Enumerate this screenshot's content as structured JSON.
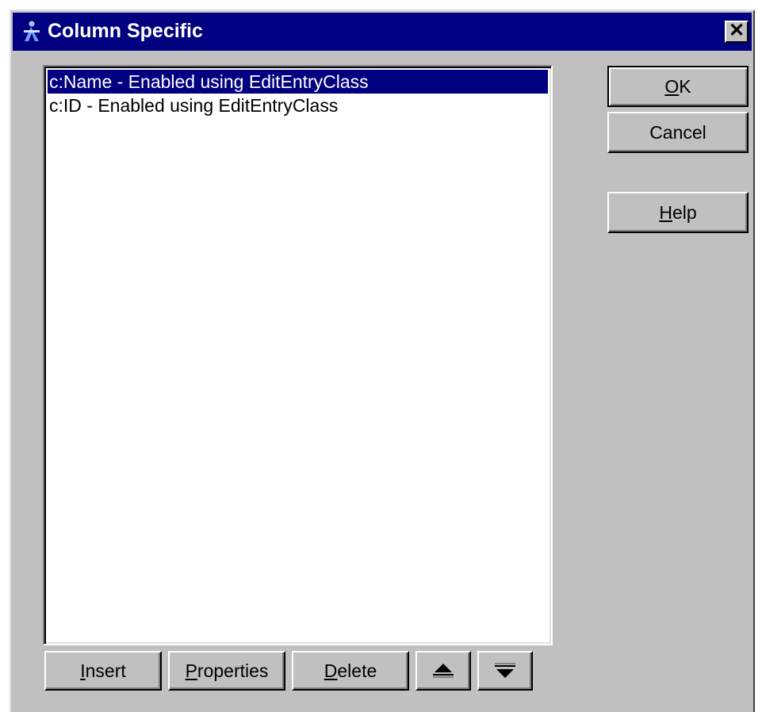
{
  "window": {
    "title": "Column Specific",
    "close_label": "✕",
    "icon": "app-figure-icon"
  },
  "list": {
    "items": [
      {
        "label": "c:Name - Enabled using EditEntryClass",
        "selected": true
      },
      {
        "label": "c:ID - Enabled using EditEntryClass",
        "selected": false
      }
    ]
  },
  "buttons": {
    "ok": {
      "mnemonic": "O",
      "rest": "K"
    },
    "cancel": "Cancel",
    "help": {
      "mnemonic": "H",
      "rest": "elp"
    },
    "insert": {
      "mnemonic": "I",
      "rest": "nsert"
    },
    "properties": {
      "mnemonic": "P",
      "rest": "roperties"
    },
    "delete": {
      "mnemonic": "D",
      "rest": "elete"
    },
    "move_up_icon": "move-up-icon",
    "move_down_icon": "move-down-icon"
  },
  "colors": {
    "titlebar": "#000080",
    "face": "#c0c0c0",
    "selection": "#000080"
  }
}
